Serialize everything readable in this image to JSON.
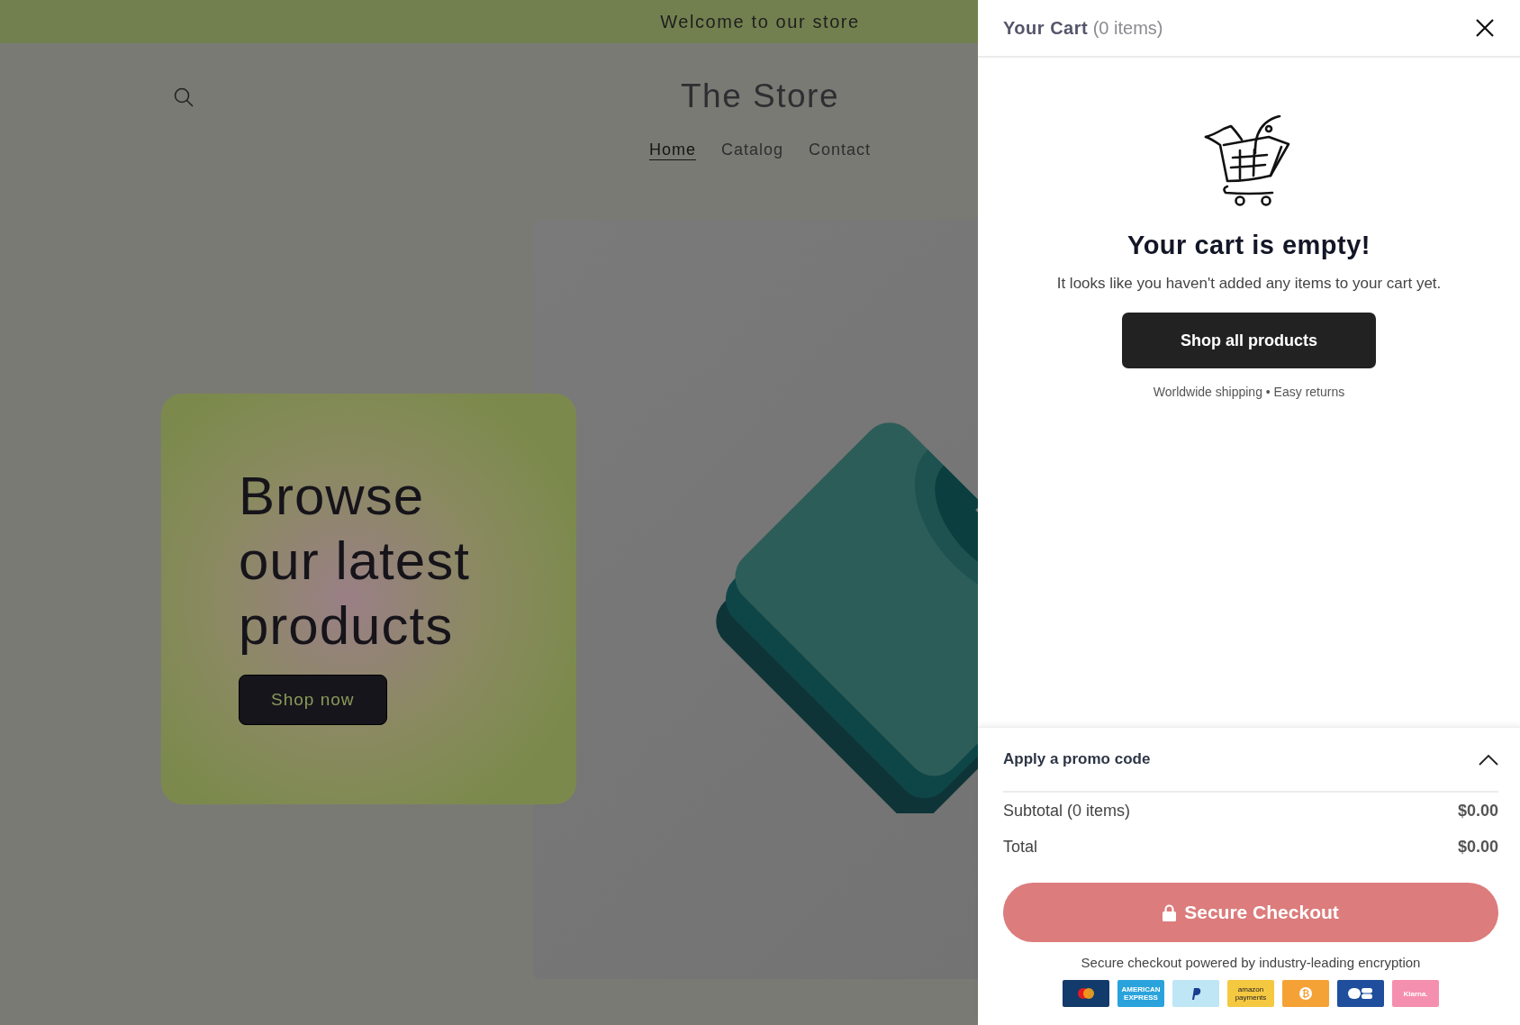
{
  "announcement": "Welcome to our store",
  "header": {
    "title": "The Store",
    "nav": [
      {
        "label": "Home",
        "selected": true
      },
      {
        "label": "Catalog",
        "selected": false
      },
      {
        "label": "Contact",
        "selected": false
      }
    ]
  },
  "hero": {
    "heading": "Browse our latest products",
    "button": "Shop now"
  },
  "cart": {
    "title": "Your Cart",
    "count": "(0 items)",
    "empty": {
      "heading": "Your cart is empty!",
      "text": "It looks like you haven't added any items to your cart yet.",
      "button": "Shop all products",
      "note": "Worldwide shipping • Easy returns"
    },
    "promo": {
      "label": "Apply a promo code",
      "expanded": true
    },
    "summary": [
      {
        "label": "Subtotal (0 items)",
        "value": "$0.00"
      },
      {
        "label": "Total",
        "value": "$0.00"
      }
    ],
    "checkout_button": "Secure Checkout",
    "secure_note": "Secure checkout powered by industry-leading encryption",
    "payment_methods": [
      {
        "kind": "mastercard"
      },
      {
        "kind": "amex",
        "text": "AMERICAN EXPRESS"
      },
      {
        "kind": "paypal"
      },
      {
        "kind": "amazon",
        "text": "amazon payments"
      },
      {
        "kind": "bitcoin",
        "text": "₿"
      },
      {
        "kind": "cb"
      },
      {
        "kind": "klarna",
        "text": "Klarna."
      }
    ]
  }
}
